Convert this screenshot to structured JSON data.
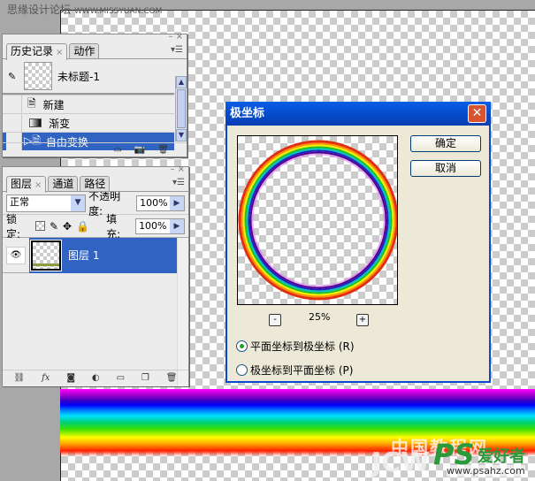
{
  "watermarks": {
    "top_cn": "思缘设计论坛",
    "top_url": "WWW.MISSYUAN.COM",
    "bottom_logo": "中国教程网 JCW PS爱好者",
    "bottom_url": "www.psahz.com"
  },
  "history_panel": {
    "tabs": [
      {
        "label": "历史记录",
        "active": true
      },
      {
        "label": "动作",
        "active": false
      }
    ],
    "snapshot": "未标题-1",
    "items": [
      {
        "label": "新建",
        "icon": "document-icon"
      },
      {
        "label": "渐变",
        "icon": "gradient-icon"
      },
      {
        "label": "自由变换",
        "icon": "document-icon",
        "selected": true
      }
    ]
  },
  "layers_panel": {
    "tabs": [
      {
        "label": "图层",
        "active": true
      },
      {
        "label": "通道",
        "active": false
      },
      {
        "label": "路径",
        "active": false
      }
    ],
    "blend_mode": "正常",
    "opacity_label": "不透明度:",
    "opacity": "100%",
    "lock_label": "锁定:",
    "fill_label": "填充:",
    "fill": "100%",
    "layers": [
      {
        "name": "图层 1",
        "visible": true,
        "selected": true
      }
    ]
  },
  "dialog": {
    "title": "极坐标",
    "ok": "确定",
    "cancel": "取消",
    "zoom": "25%",
    "zoom_out": "-",
    "zoom_in": "+",
    "options": [
      {
        "label": "平面坐标到极坐标 (R)",
        "checked": true
      },
      {
        "label": "极坐标到平面坐标 (P)",
        "checked": false
      }
    ]
  },
  "colors": {
    "selection": "#3163c2",
    "titlebar": "#0548c8"
  }
}
